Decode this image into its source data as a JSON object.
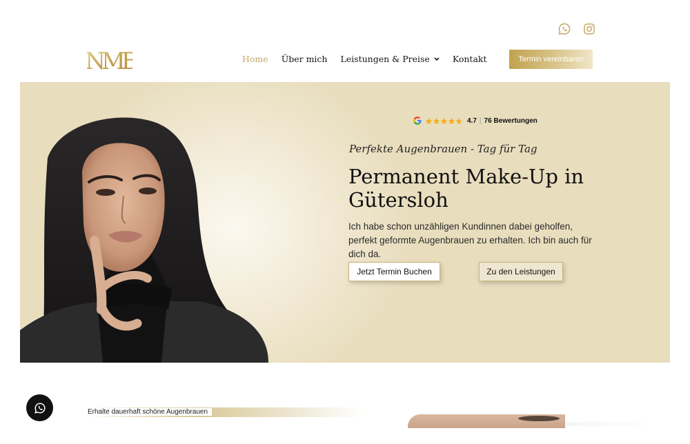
{
  "social": {
    "icons": [
      "whatsapp-icon",
      "instagram-icon"
    ]
  },
  "header": {
    "logo_text": "NMB",
    "nav": [
      {
        "label": "Home",
        "active": true
      },
      {
        "label": "Über mich",
        "active": false
      },
      {
        "label": "Leistungen & Preise",
        "active": false,
        "has_dropdown": true
      },
      {
        "label": "Kontakt",
        "active": false
      }
    ],
    "cta_label": "Termin vereinbaren"
  },
  "hero": {
    "rating": {
      "score": "4.7",
      "separator": "|",
      "count": "76 Bewertungen",
      "stars": 4.7
    },
    "tagline": "Perfekte Augenbrauen - Tag für Tag",
    "headline": "Permanent Make-Up in Gütersloh",
    "lead": "Ich habe schon unzähligen Kundinnen dabei geholfen, perfekt geformte Augenbrauen zu erhalten. Ich bin auch für dich da.",
    "primary_button": "Jetzt Termin Buchen",
    "secondary_button": "Zu den Leistungen"
  },
  "section": {
    "tag": "Erhalte dauerhaft schöne Augenbrauen"
  },
  "colors": {
    "gold": "#c7a765",
    "hero_bg": "#e8ddbd",
    "dark": "#111111"
  }
}
